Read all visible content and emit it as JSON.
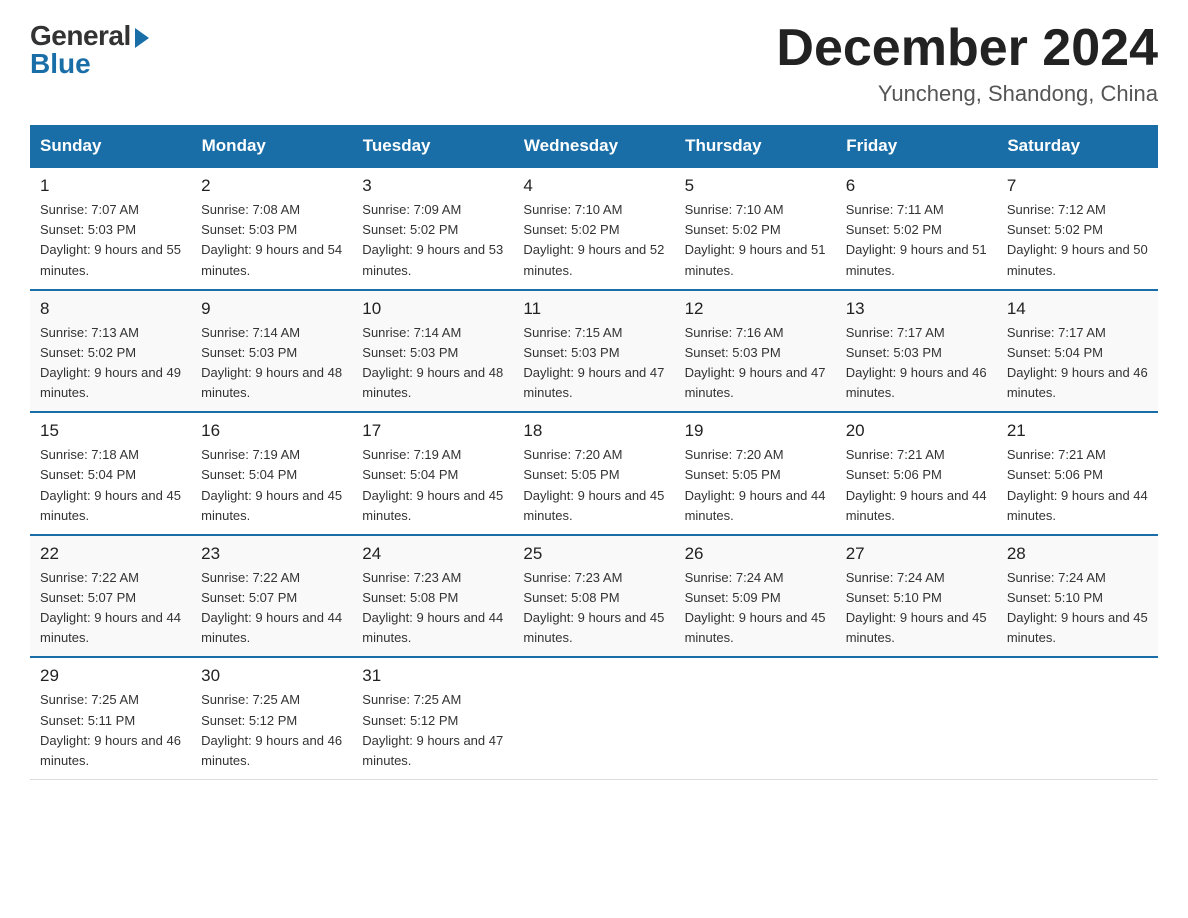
{
  "header": {
    "logo_general": "General",
    "logo_blue": "Blue",
    "month_title": "December 2024",
    "location": "Yuncheng, Shandong, China"
  },
  "days_of_week": [
    "Sunday",
    "Monday",
    "Tuesday",
    "Wednesday",
    "Thursday",
    "Friday",
    "Saturday"
  ],
  "weeks": [
    [
      {
        "day": "1",
        "sunrise": "7:07 AM",
        "sunset": "5:03 PM",
        "daylight": "9 hours and 55 minutes."
      },
      {
        "day": "2",
        "sunrise": "7:08 AM",
        "sunset": "5:03 PM",
        "daylight": "9 hours and 54 minutes."
      },
      {
        "day": "3",
        "sunrise": "7:09 AM",
        "sunset": "5:02 PM",
        "daylight": "9 hours and 53 minutes."
      },
      {
        "day": "4",
        "sunrise": "7:10 AM",
        "sunset": "5:02 PM",
        "daylight": "9 hours and 52 minutes."
      },
      {
        "day": "5",
        "sunrise": "7:10 AM",
        "sunset": "5:02 PM",
        "daylight": "9 hours and 51 minutes."
      },
      {
        "day": "6",
        "sunrise": "7:11 AM",
        "sunset": "5:02 PM",
        "daylight": "9 hours and 51 minutes."
      },
      {
        "day": "7",
        "sunrise": "7:12 AM",
        "sunset": "5:02 PM",
        "daylight": "9 hours and 50 minutes."
      }
    ],
    [
      {
        "day": "8",
        "sunrise": "7:13 AM",
        "sunset": "5:02 PM",
        "daylight": "9 hours and 49 minutes."
      },
      {
        "day": "9",
        "sunrise": "7:14 AM",
        "sunset": "5:03 PM",
        "daylight": "9 hours and 48 minutes."
      },
      {
        "day": "10",
        "sunrise": "7:14 AM",
        "sunset": "5:03 PM",
        "daylight": "9 hours and 48 minutes."
      },
      {
        "day": "11",
        "sunrise": "7:15 AM",
        "sunset": "5:03 PM",
        "daylight": "9 hours and 47 minutes."
      },
      {
        "day": "12",
        "sunrise": "7:16 AM",
        "sunset": "5:03 PM",
        "daylight": "9 hours and 47 minutes."
      },
      {
        "day": "13",
        "sunrise": "7:17 AM",
        "sunset": "5:03 PM",
        "daylight": "9 hours and 46 minutes."
      },
      {
        "day": "14",
        "sunrise": "7:17 AM",
        "sunset": "5:04 PM",
        "daylight": "9 hours and 46 minutes."
      }
    ],
    [
      {
        "day": "15",
        "sunrise": "7:18 AM",
        "sunset": "5:04 PM",
        "daylight": "9 hours and 45 minutes."
      },
      {
        "day": "16",
        "sunrise": "7:19 AM",
        "sunset": "5:04 PM",
        "daylight": "9 hours and 45 minutes."
      },
      {
        "day": "17",
        "sunrise": "7:19 AM",
        "sunset": "5:04 PM",
        "daylight": "9 hours and 45 minutes."
      },
      {
        "day": "18",
        "sunrise": "7:20 AM",
        "sunset": "5:05 PM",
        "daylight": "9 hours and 45 minutes."
      },
      {
        "day": "19",
        "sunrise": "7:20 AM",
        "sunset": "5:05 PM",
        "daylight": "9 hours and 44 minutes."
      },
      {
        "day": "20",
        "sunrise": "7:21 AM",
        "sunset": "5:06 PM",
        "daylight": "9 hours and 44 minutes."
      },
      {
        "day": "21",
        "sunrise": "7:21 AM",
        "sunset": "5:06 PM",
        "daylight": "9 hours and 44 minutes."
      }
    ],
    [
      {
        "day": "22",
        "sunrise": "7:22 AM",
        "sunset": "5:07 PM",
        "daylight": "9 hours and 44 minutes."
      },
      {
        "day": "23",
        "sunrise": "7:22 AM",
        "sunset": "5:07 PM",
        "daylight": "9 hours and 44 minutes."
      },
      {
        "day": "24",
        "sunrise": "7:23 AM",
        "sunset": "5:08 PM",
        "daylight": "9 hours and 44 minutes."
      },
      {
        "day": "25",
        "sunrise": "7:23 AM",
        "sunset": "5:08 PM",
        "daylight": "9 hours and 45 minutes."
      },
      {
        "day": "26",
        "sunrise": "7:24 AM",
        "sunset": "5:09 PM",
        "daylight": "9 hours and 45 minutes."
      },
      {
        "day": "27",
        "sunrise": "7:24 AM",
        "sunset": "5:10 PM",
        "daylight": "9 hours and 45 minutes."
      },
      {
        "day": "28",
        "sunrise": "7:24 AM",
        "sunset": "5:10 PM",
        "daylight": "9 hours and 45 minutes."
      }
    ],
    [
      {
        "day": "29",
        "sunrise": "7:25 AM",
        "sunset": "5:11 PM",
        "daylight": "9 hours and 46 minutes."
      },
      {
        "day": "30",
        "sunrise": "7:25 AM",
        "sunset": "5:12 PM",
        "daylight": "9 hours and 46 minutes."
      },
      {
        "day": "31",
        "sunrise": "7:25 AM",
        "sunset": "5:12 PM",
        "daylight": "9 hours and 47 minutes."
      },
      null,
      null,
      null,
      null
    ]
  ]
}
